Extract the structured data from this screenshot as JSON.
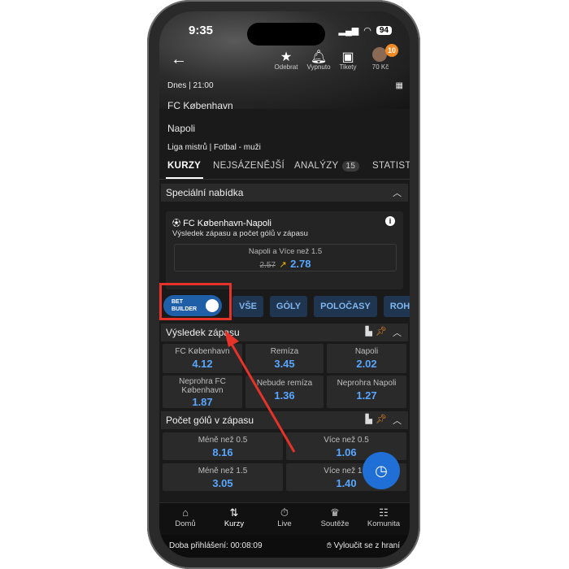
{
  "status": {
    "time": "9:35",
    "battery": "94"
  },
  "topbar": {
    "items": [
      {
        "icon": "star-icon",
        "label": "Odebrat"
      },
      {
        "icon": "bell-icon",
        "label": "Vypnuto"
      },
      {
        "icon": "ticket-icon",
        "label": "Tikety"
      }
    ],
    "avatar_badge": "10",
    "balance": "70 Kč"
  },
  "match": {
    "time": "Dnes | 21:00",
    "home": "FC København",
    "away": "Napoli",
    "league": "Liga mistrů | Fotbal - muži"
  },
  "tabs": [
    {
      "label": "KURZY",
      "active": true
    },
    {
      "label": "NEJSÁZENĚJŠÍ"
    },
    {
      "label": "ANALÝZY",
      "count": "15"
    },
    {
      "label": "STATIST"
    }
  ],
  "special": {
    "header": "Speciální nabídka",
    "title": "FC København-Napoli",
    "subtitle": "Výsledek zápasu a počet gólů v zápasu",
    "odd_label": "Napoli a Více než 1.5",
    "old_odd": "2.57",
    "new_odd": "2.78"
  },
  "filters": {
    "bet_builder_line1": "BET",
    "bet_builder_line2": "BUILDER",
    "chips": [
      "VŠE",
      "GÓLY",
      "POLOČASY",
      "ROH"
    ]
  },
  "result": {
    "header": "Výsledek zápasu",
    "cells": [
      {
        "label": "FC København",
        "value": "4.12"
      },
      {
        "label": "Remíza",
        "value": "3.45"
      },
      {
        "label": "Napoli",
        "value": "2.02"
      },
      {
        "label": "Neprohra FC København",
        "value": "1.87"
      },
      {
        "label": "Nebude remíza",
        "value": "1.36"
      },
      {
        "label": "Neprohra Napoli",
        "value": "1.27"
      }
    ]
  },
  "goals": {
    "header": "Počet gólů v zápasu",
    "cells": [
      {
        "label": "Méně než 0.5",
        "value": "8.16"
      },
      {
        "label": "Více než 0.5",
        "value": "1.06"
      },
      {
        "label": "Méně než 1.5",
        "value": "3.05"
      },
      {
        "label": "Více než 1.5",
        "value": "1.40"
      }
    ]
  },
  "bottom_nav": [
    {
      "icon": "home-icon",
      "label": "Domů"
    },
    {
      "icon": "odds-icon",
      "label": "Kurzy"
    },
    {
      "icon": "stopwatch-icon",
      "label": "Live"
    },
    {
      "icon": "trophy-icon",
      "label": "Soutěže"
    },
    {
      "icon": "community-icon",
      "label": "Komunita"
    }
  ],
  "footer": {
    "login_time": "Doba přihlášení: 00:08:09",
    "exclude": "Vyloučit se z hraní"
  },
  "colors": {
    "accent": "#58a6ff",
    "highlight": "#e53329",
    "badge": "#f08a24"
  }
}
